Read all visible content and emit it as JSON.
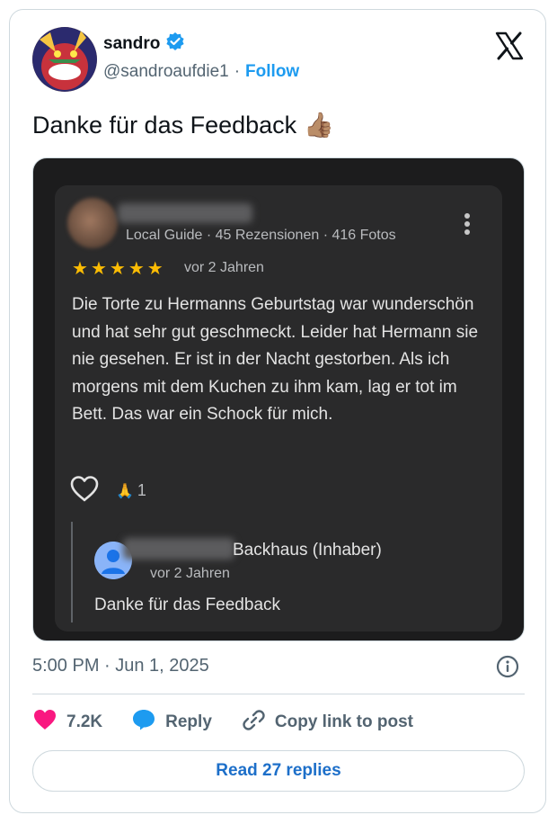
{
  "author": {
    "display_name": "sandro",
    "handle": "@sandroaufdie1",
    "separator": "·",
    "follow_label": "Follow"
  },
  "tweet": {
    "text": "Danke für das Feedback",
    "emoji": "👍🏽"
  },
  "review": {
    "meta": "Local Guide · 45 Rezensionen · 416 Fotos",
    "rating": 5,
    "date": "vor 2 Jahren",
    "text": "Die Torte zu Hermanns Geburtstag war wunderschön und hat sehr gut geschmeckt. Leider hat Hermann sie nie gesehen. Er ist in der Nacht gestorben. Als ich morgens mit dem Kuchen zu ihm kam, lag er tot im Bett. Das war ein Schock für mich.",
    "reaction_count": "1",
    "reaction_emoji": "🙏",
    "owner_reply": {
      "name": "Backhaus (Inhaber)",
      "date": "vor 2 Jahren",
      "text": "Danke für das Feedback"
    }
  },
  "timestamp": "5:00 PM · Jun 1, 2025",
  "actions": {
    "likes": "7.2K",
    "reply_label": "Reply",
    "copy_link_label": "Copy link to post"
  },
  "read_replies_label": "Read 27 replies",
  "colors": {
    "verified_blue": "#1d9bf0",
    "like_pink": "#f91880",
    "star_yellow": "#fbbc04",
    "review_bg": "#2a2a2b"
  },
  "icons": [
    "verified-badge-icon",
    "x-logo-icon",
    "more-vertical-icon",
    "star-icon",
    "heart-outline-icon",
    "prayer-hands-icon",
    "person-icon",
    "info-icon",
    "heart-filled-icon",
    "speech-bubble-icon",
    "link-icon"
  ]
}
